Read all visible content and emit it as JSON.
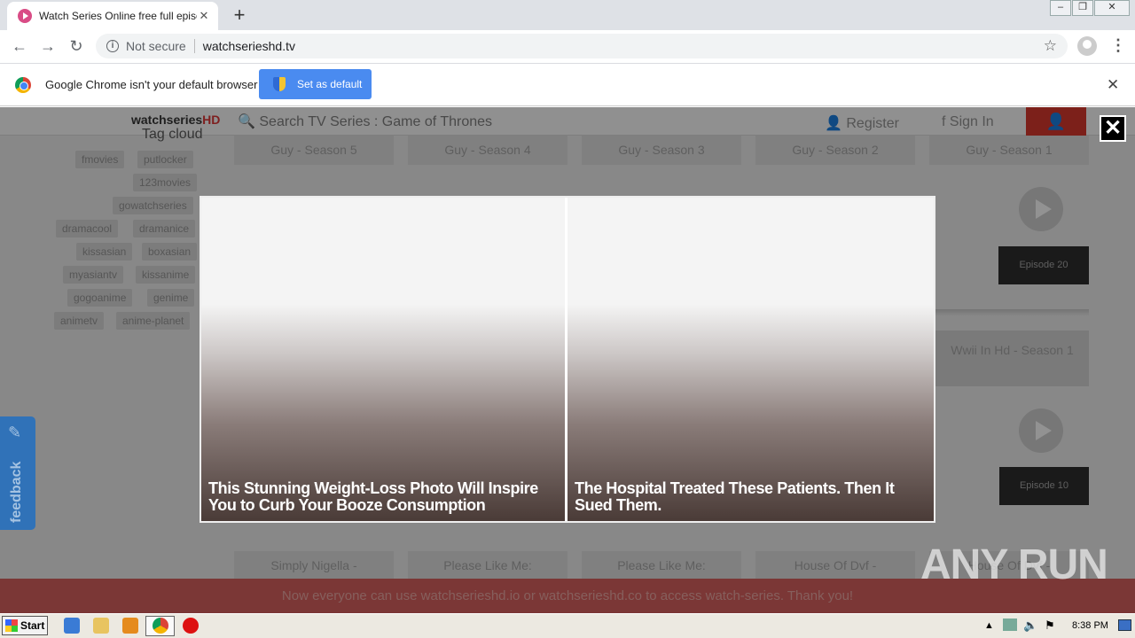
{
  "browser": {
    "tab_title": "Watch Series Online free full episode",
    "url_security": "Not secure",
    "url": "watchserieshd.tv",
    "infobar_text": "Google Chrome isn't your default browser",
    "set_default_label": "Set as default"
  },
  "site": {
    "logo": "watchseries",
    "logo_suffix": "HD",
    "search_placeholder": "Search TV Series : Game of Thrones",
    "register_label": "Register",
    "signin_label": "Sign In",
    "tag_cloud_title": "Tag cloud",
    "tags": [
      "fmovies",
      "putlocker",
      "123movies",
      "gowatchseries",
      "dramacool",
      "dramanice",
      "kissasian",
      "boxasian",
      "myasiantv",
      "kissanime",
      "gogoanime",
      "genime",
      "animetv",
      "anime-planet"
    ],
    "season_cards": [
      "Guy - Season 5",
      "Guy - Season 4",
      "Guy - Season 3",
      "Guy - Season 2",
      "Guy - Season 1"
    ],
    "episode_labels": [
      "Episode 20",
      "Episode 10"
    ],
    "wwii_card": "Wwii In Hd - Season 1",
    "bottom_cards": [
      "Simply Nigella -",
      "Please Like Me:",
      "Please Like Me:",
      "House Of Dvf -",
      "House Of Dvf -"
    ],
    "banner": "Now everyone can use watchserieshd.io or watchserieshd.co to access watch-series. Thank you!",
    "feedback_label": "feedback"
  },
  "modal": {
    "stories": [
      {
        "caption": "This Stunning Weight-Loss Photo Will Inspire You to Curb Your Booze Consumption"
      },
      {
        "caption": "The Hospital Treated These Patients. Then It Sued Them."
      }
    ]
  },
  "watermark": "ANY RUN",
  "taskbar": {
    "start_label": "Start",
    "clock": "8:38 PM"
  }
}
